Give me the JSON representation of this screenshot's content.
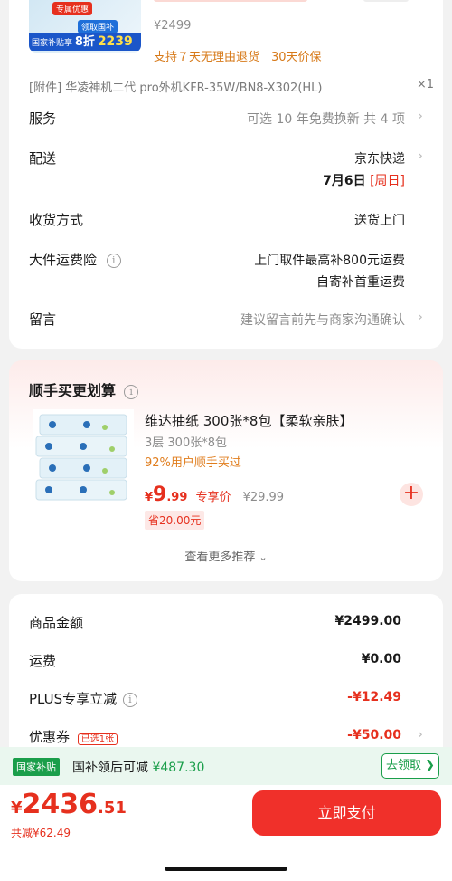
{
  "product": {
    "price": "¥2499",
    "promises": "支持７天无理由退货　30天价保",
    "banner_tag": "国家补贴享",
    "banner_discount": "8折",
    "banner_num": "2239",
    "banner_top": "专属优惠",
    "banner_mid": "领取国补"
  },
  "accessory": {
    "text": "[附件] 华凌神机二代 pro外机KFR-35W/BN8-X302(HL)",
    "qty": "×1"
  },
  "rows": {
    "service_label": "服务",
    "service_value": "可选 10 年免费换新 共 4 项",
    "delivery_label": "配送",
    "delivery_value": "京东快递",
    "delivery_date": "7月6日",
    "delivery_day": "[周日]",
    "receive_label": "收货方式",
    "receive_value": "送货上门",
    "insurance_label": "大件运费险",
    "insurance_value1": "上门取件最高补800元运费",
    "insurance_value2": "自寄补首重运费",
    "message_label": "留言",
    "message_placeholder": "建议留言前先与商家沟通确认"
  },
  "addon": {
    "title": "顺手买更划算",
    "product_title": "维达抽纸 300张*8包【柔软亲肤】",
    "spec": "3层 300张*8包",
    "buyers": "92%用户顺手买过",
    "price_symbol": "¥",
    "price_int": "9",
    "price_dec": ".99",
    "price_tag": "专享价",
    "orig_price": "¥29.99",
    "save": "省20.00元",
    "more": "查看更多推荐"
  },
  "summary": {
    "goods_label": "商品金额",
    "goods_value": "¥2499.00",
    "shipping_label": "运费",
    "shipping_value": "¥0.00",
    "plus_label": "PLUS专享立减",
    "plus_value": "-¥12.49",
    "coupon_label": "优惠券",
    "coupon_badge": "已选1张",
    "coupon_value": "-¥50.00"
  },
  "subsidy": {
    "badge": "国家补贴",
    "text": "国补领后可减",
    "amount": "¥487.30",
    "button": "去领取"
  },
  "footer": {
    "symbol": "¥",
    "total_int": "2436",
    "total_dec": ".51",
    "saved": "共减¥62.49",
    "pay_button": "立即支付"
  },
  "colors": {
    "accent_red": "#e6301e",
    "pay_button": "#f0302a",
    "subsidy_green": "#1a9e4a",
    "promise_orange": "#d77a1a"
  }
}
